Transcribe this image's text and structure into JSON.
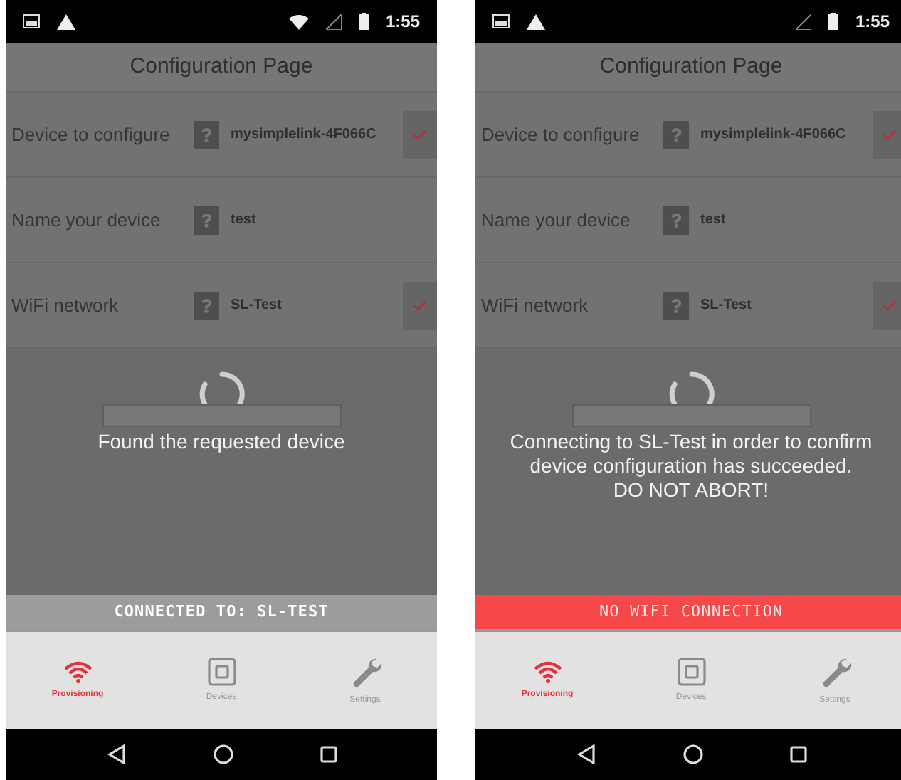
{
  "phones": [
    {
      "status_bar": {
        "time": "1:55",
        "wifi": true
      },
      "title": "Configuration Page",
      "rows": [
        {
          "kind": "select",
          "label": "Device to configure",
          "value": "mysimplelink-4F066C",
          "checked": true
        },
        {
          "kind": "input",
          "label": "Name your device",
          "value": "test"
        },
        {
          "kind": "select",
          "label": "WiFi network",
          "value": "SL-Test",
          "checked": true
        }
      ],
      "message": [
        "Found the requested device"
      ],
      "banner": {
        "kind": "ok",
        "text": "CONNECTED TO: SL-TEST"
      },
      "nav": [
        {
          "label": "Provisioning",
          "selected": true
        },
        {
          "label": "Devices",
          "selected": false
        },
        {
          "label": "Settings",
          "selected": false
        }
      ]
    },
    {
      "status_bar": {
        "time": "1:55",
        "wifi": false
      },
      "title": "Configuration Page",
      "rows": [
        {
          "kind": "select",
          "label": "Device to configure",
          "value": "mysimplelink-4F066C",
          "checked": true
        },
        {
          "kind": "input",
          "label": "Name your device",
          "value": "test"
        },
        {
          "kind": "select",
          "label": "WiFi network",
          "value": "SL-Test",
          "checked": true
        }
      ],
      "message": [
        "Connecting to SL-Test in order to confirm",
        "device configuration has succeeded.",
        "DO NOT ABORT!"
      ],
      "banner": {
        "kind": "error",
        "text": "NO WIFI CONNECTION"
      },
      "nav": [
        {
          "label": "Provisioning",
          "selected": true
        },
        {
          "label": "Devices",
          "selected": false
        },
        {
          "label": "Settings",
          "selected": false
        }
      ]
    }
  ]
}
